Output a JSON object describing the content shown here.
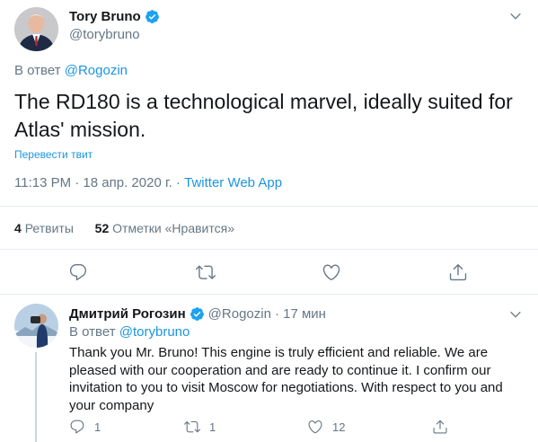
{
  "main_tweet": {
    "author_name": "Tory Bruno",
    "author_handle": "@torybruno",
    "reply_prefix": "В ответ",
    "reply_to": "@Rogozin",
    "text": "The RD180 is a technological marvel, ideally suited for Atlas' mission.",
    "translate_label": "Перевести твит",
    "timestamp": "11:13 PM · 18 апр. 2020 г.",
    "separator": " · ",
    "source": "Twitter Web App",
    "retweets_count": "4",
    "retweets_label": "Ретвиты",
    "likes_count": "52",
    "likes_label": "Отметки «Нравится»",
    "actions": [
      "reply-icon",
      "retweet-icon",
      "like-icon",
      "share-icon"
    ]
  },
  "reply_tweet": {
    "author_name": "Дмитрий Рогозин",
    "author_handle": "@Rogozin",
    "time": "· 17 мин",
    "reply_prefix": "В ответ",
    "reply_to": "@torybruno",
    "text": "Thank you Mr. Bruno!  This engine is truly efficient and reliable.  We are pleased with our cooperation and are ready to continue it.  I confirm our invitation to you to visit Moscow for negotiations.  With respect to you and your company",
    "reply_count": "1",
    "retweet_count": "1",
    "like_count": "12"
  },
  "colors": {
    "accent": "#1b95e0",
    "muted": "#657786",
    "divider": "#e6ecf0",
    "verified": "#1da1f2"
  }
}
